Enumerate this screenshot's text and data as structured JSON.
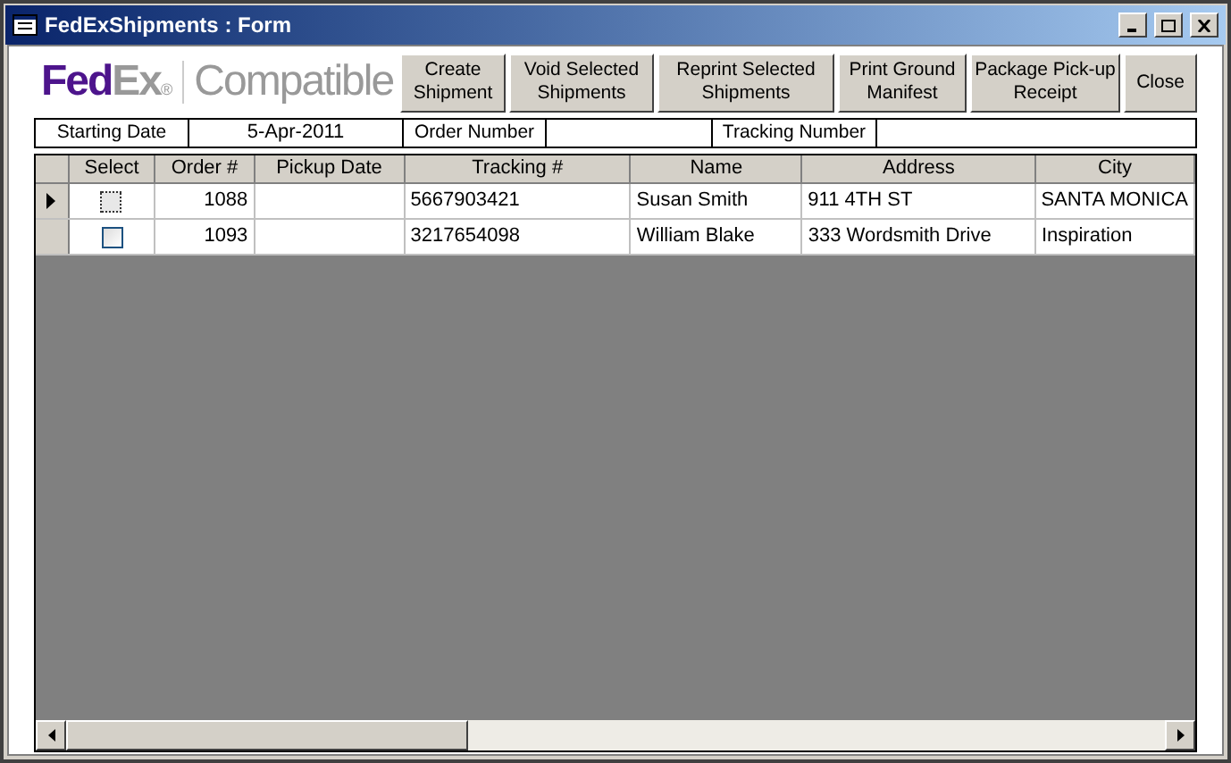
{
  "window": {
    "title": "FedExShipments : Form"
  },
  "logo": {
    "brand_left": "Fed",
    "brand_right": "Ex",
    "registered": "®",
    "tagline": "Compatible"
  },
  "buttons": [
    {
      "label": "Create Shipment"
    },
    {
      "label": "Void Selected Shipments"
    },
    {
      "label": "Reprint Selected Shipments"
    },
    {
      "label": "Print Ground Manifest"
    },
    {
      "label": "Package Pick-up Receipt"
    },
    {
      "label": "Close"
    }
  ],
  "filters": [
    {
      "label": "Starting Date",
      "value": "5-Apr-2011"
    },
    {
      "label": "Order Number"
    },
    {
      "label": "Tracking Number"
    }
  ],
  "table": {
    "columns": [
      "Select",
      "Order #",
      "Pickup Date",
      "Tracking #",
      "Name",
      "Address",
      "City"
    ],
    "rows": [
      {
        "selected": true,
        "checked": false,
        "order": "1088",
        "tracking": "5667903421",
        "name": "Susan Smith",
        "address": "911 4TH ST",
        "city": "SANTA MONICA"
      },
      {
        "selected": false,
        "checked": false,
        "order": "1093",
        "tracking": "3217654098",
        "name": "William Blake",
        "address": "333 Wordsmith Drive",
        "city": "Inspiration"
      }
    ]
  }
}
